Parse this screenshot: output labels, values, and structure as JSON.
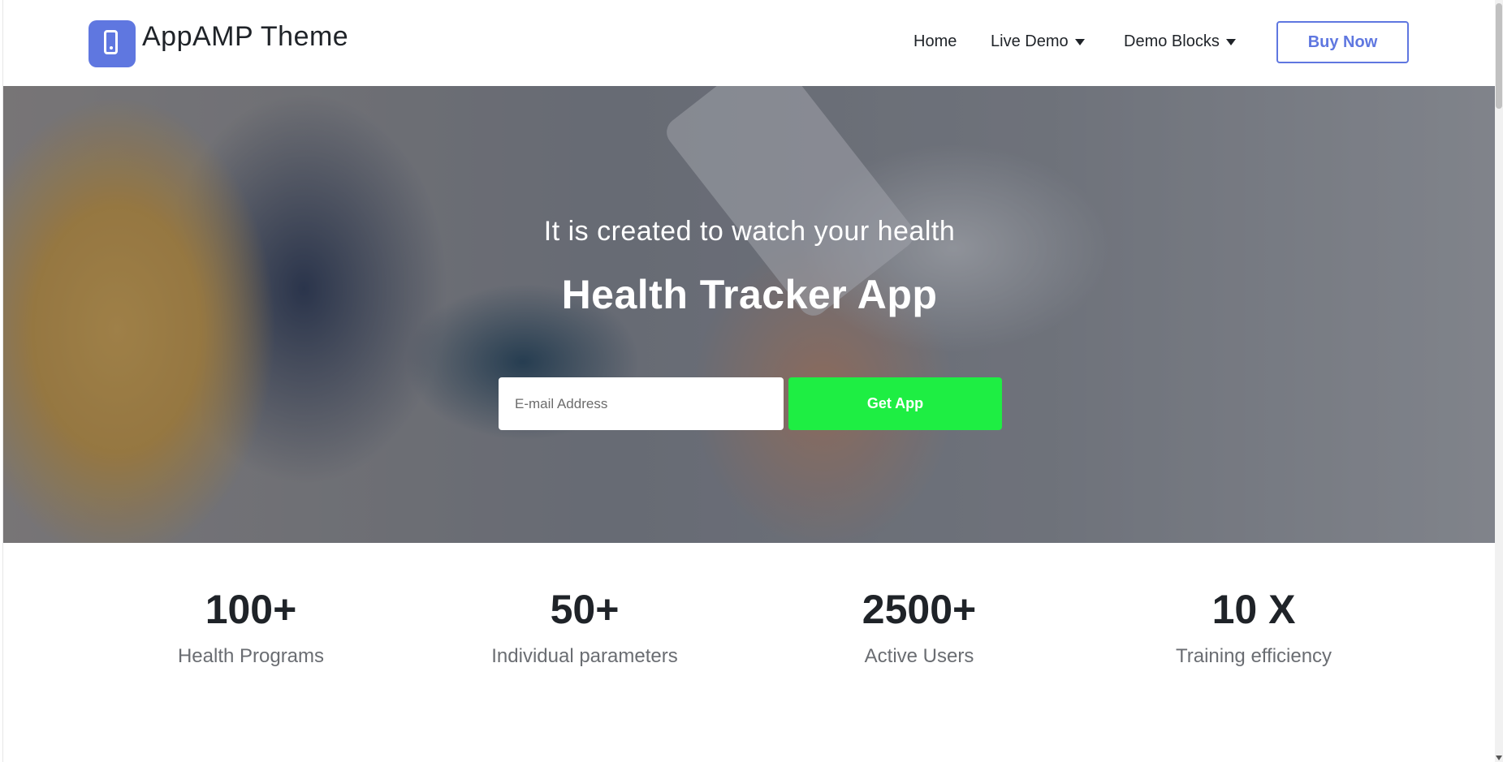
{
  "brand": {
    "name": "AppAMP Theme",
    "logo_icon": "smartphone-icon",
    "accent": "#5f77e0"
  },
  "nav": {
    "items": [
      {
        "label": "Home",
        "has_caret": false
      },
      {
        "label": "Live Demo",
        "has_caret": true
      },
      {
        "label": "Demo Blocks",
        "has_caret": true
      }
    ],
    "buy_label": "Buy Now"
  },
  "hero": {
    "subtitle": "It is created to watch your health",
    "title": "Health Tracker App",
    "email_placeholder": "E-mail Address",
    "cta_label": "Get App",
    "cta_color": "#1eee43"
  },
  "stats": [
    {
      "value": "100+",
      "label": "Health Programs"
    },
    {
      "value": "50+",
      "label": "Individual parameters"
    },
    {
      "value": "2500+",
      "label": "Active Users"
    },
    {
      "value": "10 X",
      "label": "Training efficiency"
    }
  ]
}
